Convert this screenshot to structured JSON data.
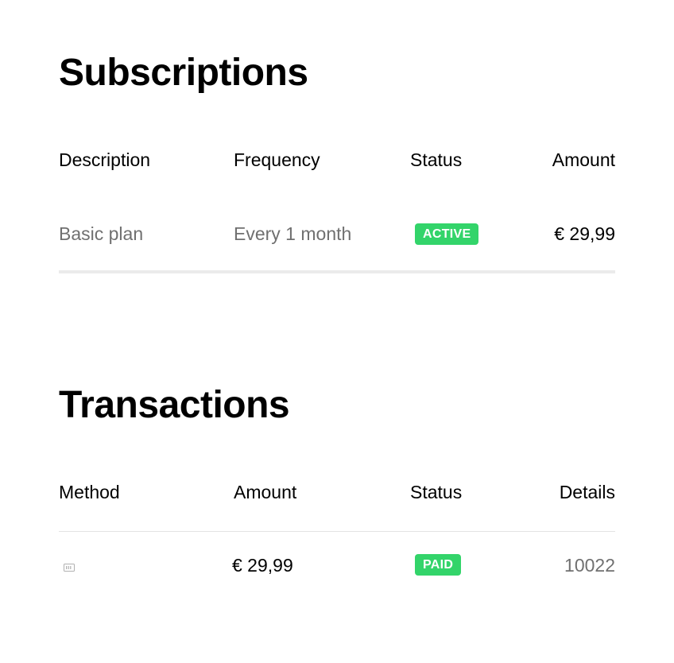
{
  "subscriptions": {
    "title": "Subscriptions",
    "headers": {
      "description": "Description",
      "frequency": "Frequency",
      "status": "Status",
      "amount": "Amount"
    },
    "rows": [
      {
        "description": "Basic plan",
        "frequency": "Every 1 month",
        "status": "ACTIVE",
        "amount": "€ 29,99"
      }
    ]
  },
  "transactions": {
    "title": "Transactions",
    "headers": {
      "method": "Method",
      "amount": "Amount",
      "status": "Status",
      "details": "Details"
    },
    "rows": [
      {
        "method_icon": "credit-card-icon",
        "amount": "€ 29,99",
        "status": "PAID",
        "details": "10022"
      }
    ]
  },
  "colors": {
    "badge_green": "#33d46a",
    "muted_text": "#707070",
    "divider": "#ebebeb"
  }
}
